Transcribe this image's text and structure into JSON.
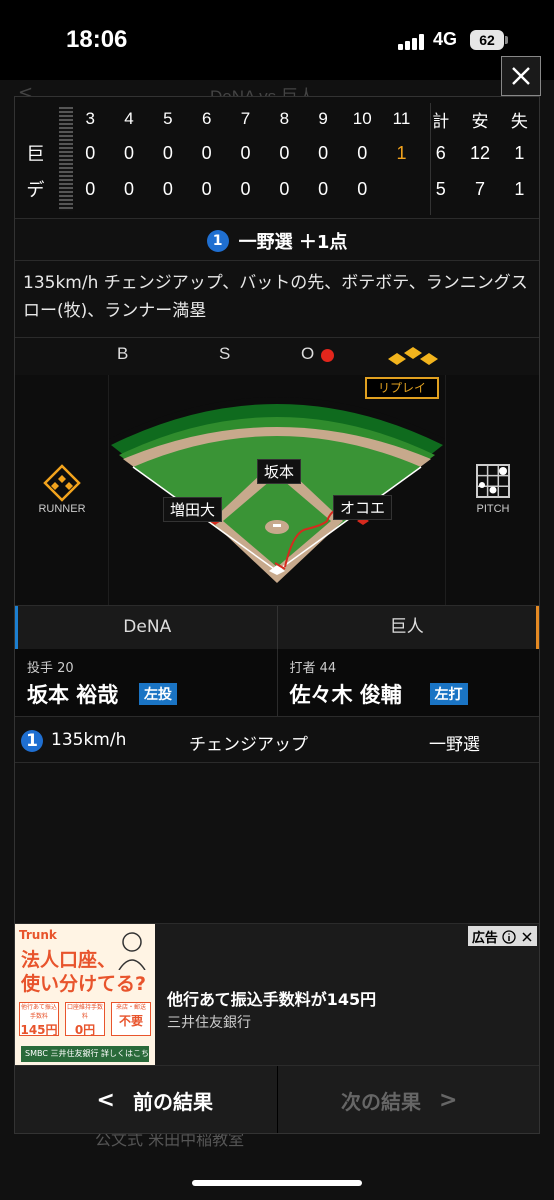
{
  "status_bar": {
    "time": "18:06",
    "network": "4G",
    "battery": "62"
  },
  "background": {
    "title": "DeNA vs 巨人",
    "back": "<",
    "bottom_text": "公文式 米田中稲教室"
  },
  "scoreboard": {
    "innings": [
      "3",
      "4",
      "5",
      "6",
      "7",
      "8",
      "9",
      "10",
      "11"
    ],
    "totals_headers": [
      "計",
      "安",
      "失"
    ],
    "rows": [
      {
        "team": "巨",
        "innings": [
          "0",
          "0",
          "0",
          "0",
          "0",
          "0",
          "0",
          "0",
          "1"
        ],
        "totals": [
          "6",
          "12",
          "1"
        ]
      },
      {
        "team": "デ",
        "innings": [
          "0",
          "0",
          "0",
          "0",
          "0",
          "0",
          "0",
          "0",
          ""
        ],
        "totals": [
          "5",
          "7",
          "1"
        ]
      }
    ]
  },
  "play": {
    "number": "1",
    "headline": "一野選 ＋1点",
    "description": "135km/h チェンジアップ、バットの先、ボテボテ、ランニングスロー(牧)、ランナー満塁",
    "bso": {
      "b": "B",
      "s": "S",
      "o": "O",
      "outs": 1
    }
  },
  "field": {
    "replay_label": "リプレイ",
    "runner_label": "RUNNER",
    "pitch_label": "PITCH",
    "players": {
      "second": "坂本",
      "third": "増田大",
      "first": "オコエ"
    }
  },
  "teams": {
    "home": "DeNA",
    "away": "巨人"
  },
  "matchup": {
    "pitcher": {
      "role": "投手 20",
      "name": "坂本 裕哉",
      "hand": "左投"
    },
    "batter": {
      "role": "打者 44",
      "name": "佐々木 俊輔",
      "hand": "左打"
    }
  },
  "pitch_log": {
    "number": "1",
    "speed": "135km/h",
    "type": "チェンジアップ",
    "result": "一野選"
  },
  "ad": {
    "brand": "Trunk",
    "copy_line1": "法人口座、",
    "copy_line2": "使い分けてる?",
    "chips": [
      {
        "small": "他行あて振込手数料",
        "big": "145円"
      },
      {
        "small": "口座維持手数料",
        "big": "0円"
      },
      {
        "small": "来店・郵送",
        "big": "不要"
      }
    ],
    "footer": "SMBC 三井住友銀行 詳しくはこちら",
    "tag": "広告",
    "title": "他行あて振込手数料が145円",
    "subtitle": "三井住友銀行"
  },
  "nav": {
    "prev_label": "前の結果",
    "next_label": "次の結果",
    "prev_chevron": "<",
    "next_chevron": ">"
  },
  "colors": {
    "accent_blue": "#1f6fd1",
    "orange": "#f2a31d",
    "out_red": "#e2261c",
    "dena_blue": "#1c7fd0",
    "giants_orange": "#e58a23"
  }
}
